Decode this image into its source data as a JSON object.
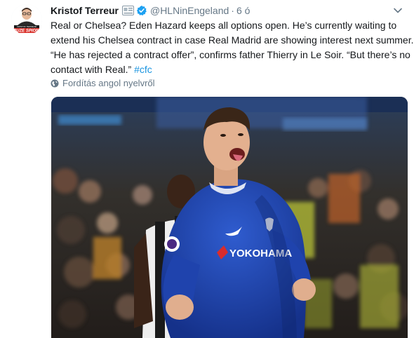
{
  "tweet": {
    "author_name": "Kristof Terreur",
    "handle": "@HLNinEngeland",
    "separator": "·",
    "time": "6 ó",
    "text_lines": [
      "Real or Chelsea? Eden Hazard keeps all options open. He’s currently waiting to",
      "extend his Chelsea contract in case Real Madrid are showing interest next summer.",
      "“He has rejected a contract offer”, confirms father Thierry in Le Soir. “But there’s no"
    ],
    "text_last_line": "contact with Real.” ",
    "hashtag": "#cfc",
    "translate_label": "Fordítás angol nyelvről",
    "avatar_text": {
      "small": "KRISTOF TERREUR",
      "big": "BUZE SPIONI"
    },
    "photo_text": {
      "shirt_sponsor": "YOKOHAMA"
    }
  },
  "colors": {
    "link": "#1b95e0",
    "muted": "#657786",
    "verified": "#1da1f2",
    "text": "#14171a",
    "chelsea_blue": "#1b3fa6"
  },
  "icons": [
    "id-card-icon",
    "verified-badge-icon",
    "chevron-down-icon",
    "globe-icon"
  ]
}
